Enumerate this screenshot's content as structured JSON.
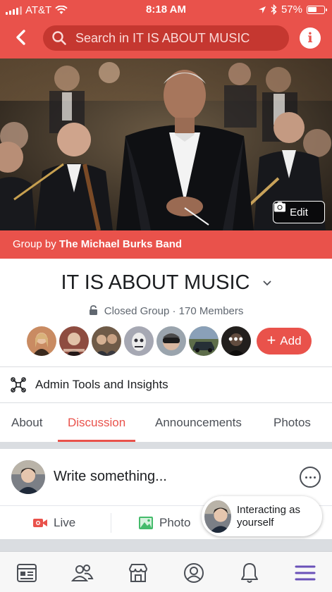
{
  "status_bar": {
    "carrier": "AT&T",
    "time": "8:18 AM",
    "battery": "57%"
  },
  "header": {
    "search_placeholder": "Search in IT IS ABOUT MUSIC",
    "info_icon": "i"
  },
  "cover": {
    "edit_label": "Edit",
    "group_by_prefix": "Group by",
    "group_by_owner": "The Michael Burks Band"
  },
  "group": {
    "name": "IT IS ABOUT MUSIC",
    "privacy": "Closed Group",
    "separator": "·",
    "members": "170 Members",
    "add_button": "Add",
    "member_avatars": [
      {
        "name": "member-avatar-1",
        "bg": "#c98b62",
        "fg": "#3a2a1e"
      },
      {
        "name": "member-avatar-2",
        "bg": "#8e4c40",
        "fg": "#e2c2a8"
      },
      {
        "name": "member-avatar-3",
        "bg": "#6f5b48",
        "fg": "#d5b193"
      },
      {
        "name": "member-avatar-4",
        "bg": "#a6a8b3",
        "fg": "#2c2c34"
      },
      {
        "name": "member-avatar-5",
        "bg": "#9aa4ad",
        "fg": "#1c1c1c"
      },
      {
        "name": "member-avatar-6",
        "bg": "#5d6d4a",
        "fg": "#263036"
      },
      {
        "name": "member-avatar-7",
        "bg": "#3f3a36",
        "fg": "#b28a74"
      }
    ]
  },
  "admin": {
    "label": "Admin Tools and Insights"
  },
  "tabs": [
    {
      "label": "About",
      "active": false
    },
    {
      "label": "Discussion",
      "active": true
    },
    {
      "label": "Announcements",
      "active": false
    },
    {
      "label": "Photos",
      "active": false
    }
  ],
  "composer": {
    "placeholder": "Write something...",
    "live_label": "Live",
    "photo_label": "Photo"
  },
  "tooltip": {
    "text": "Interacting as yourself"
  },
  "bottom_nav": [
    {
      "name": "nav-news-feed-icon"
    },
    {
      "name": "nav-friends-icon"
    },
    {
      "name": "nav-marketplace-icon"
    },
    {
      "name": "nav-profile-icon"
    },
    {
      "name": "nav-notifications-icon"
    },
    {
      "name": "nav-menu-icon",
      "active": true
    }
  ],
  "colors": {
    "brand": "#e9524b",
    "brand_dark": "#c53730",
    "active_nav": "#6a51b8"
  }
}
